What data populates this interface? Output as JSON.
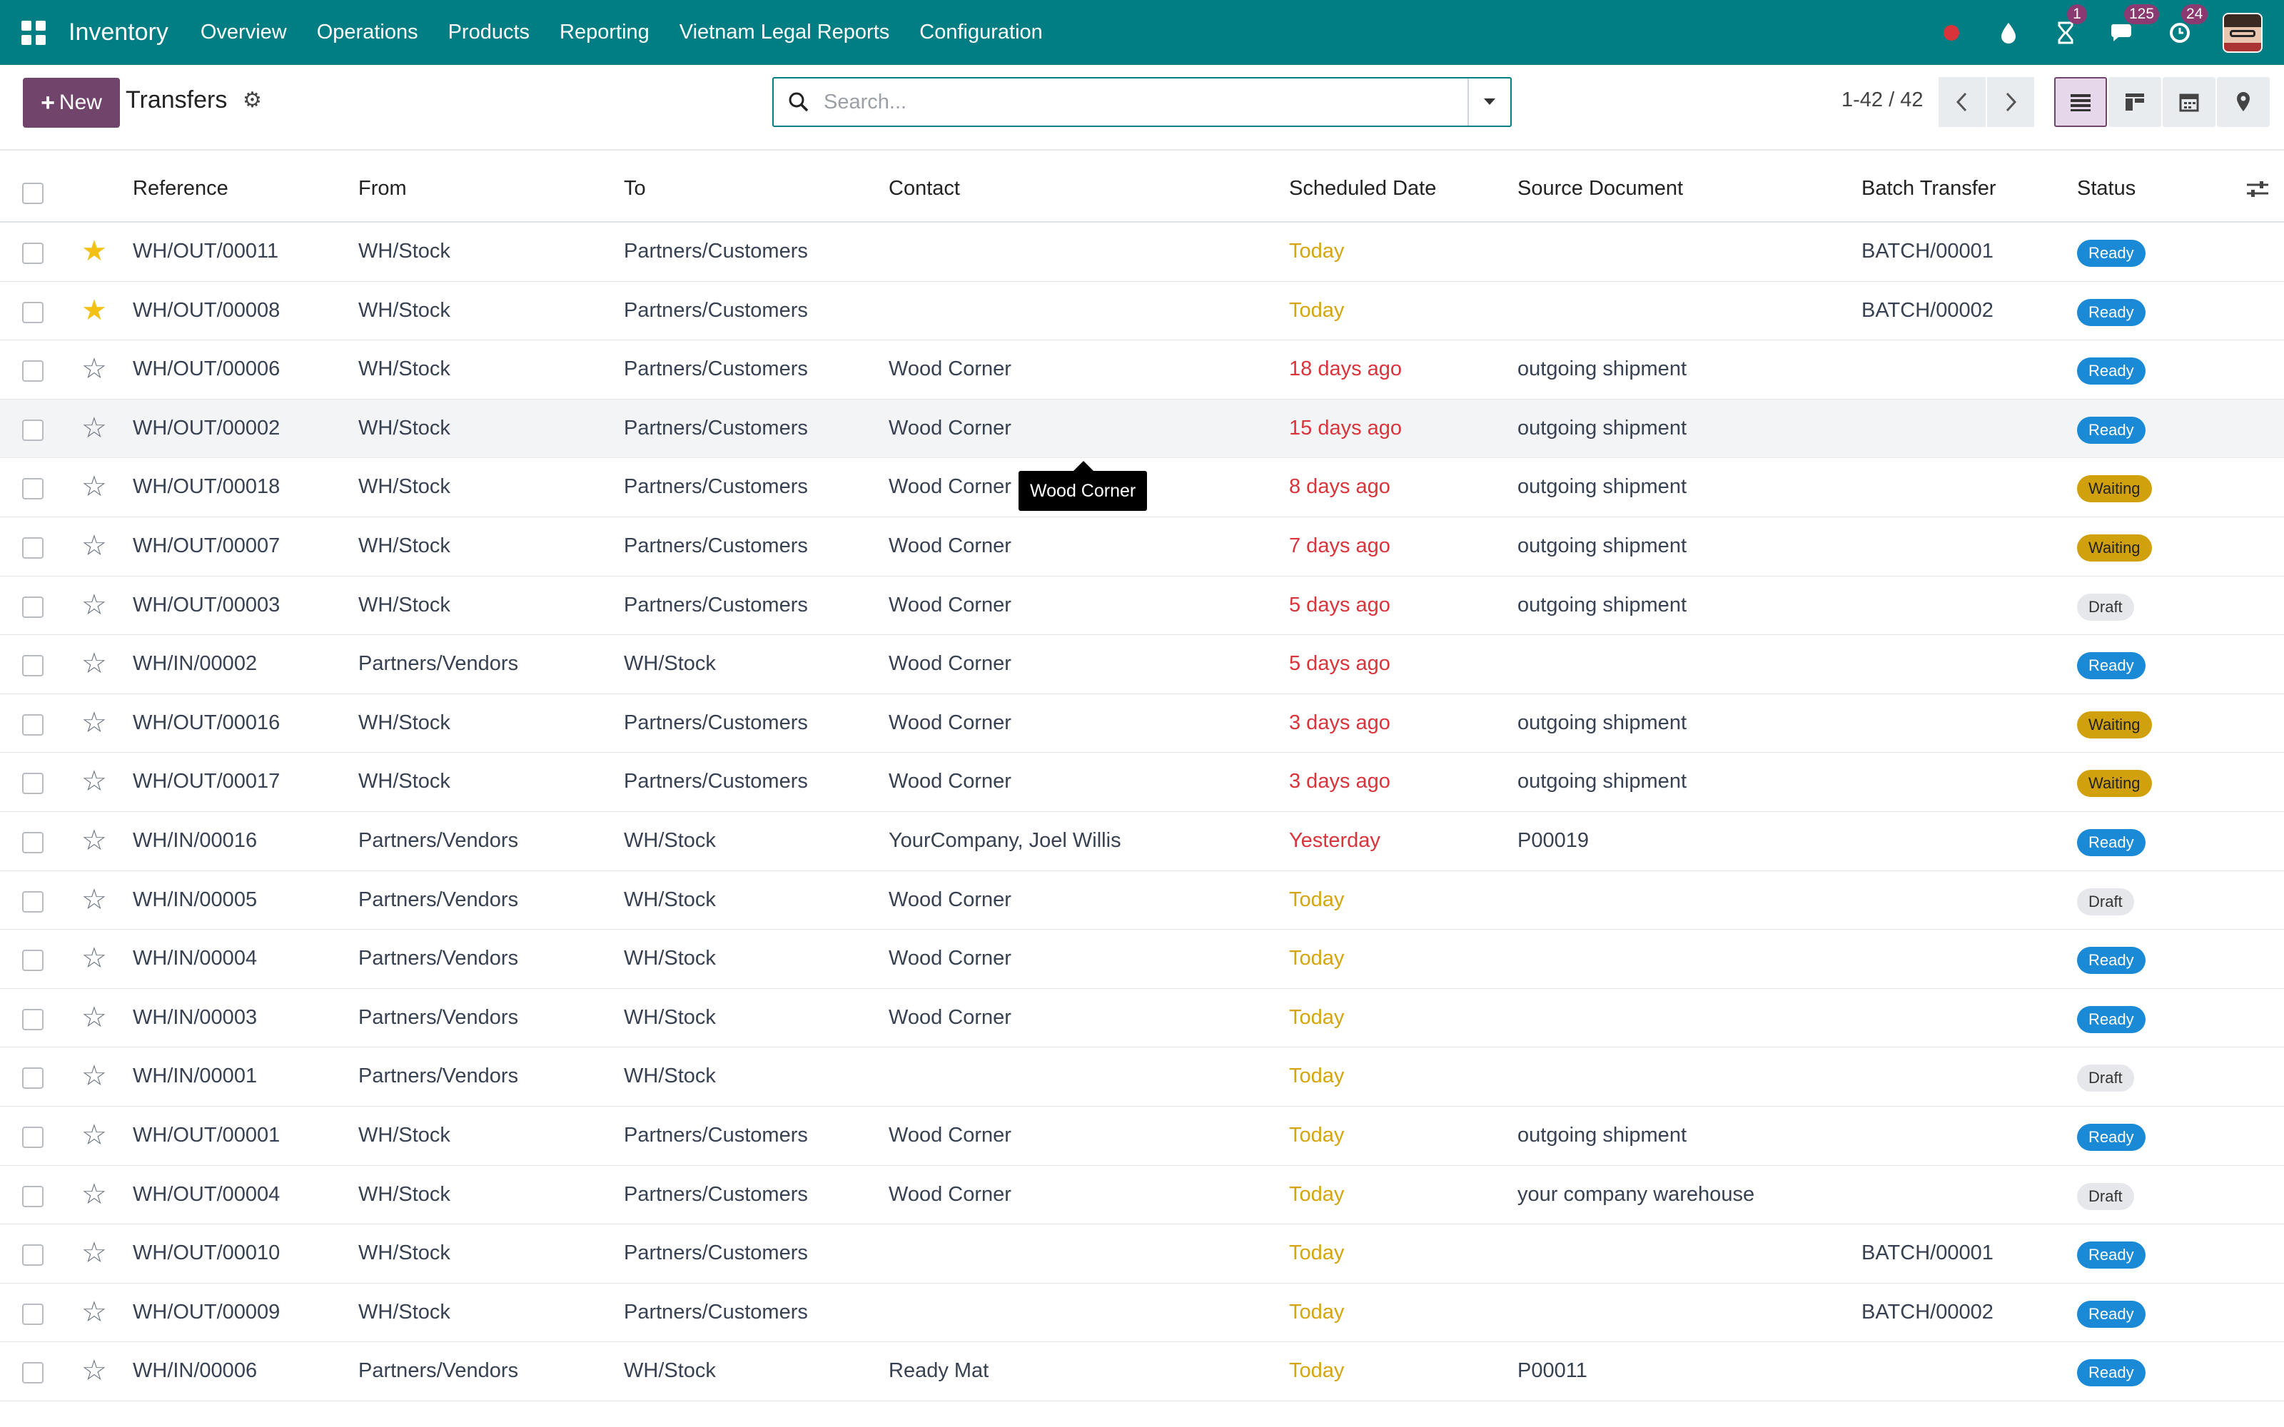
{
  "navbar": {
    "brand": "Inventory",
    "menu": [
      "Overview",
      "Operations",
      "Products",
      "Reporting",
      "Vietnam Legal Reports",
      "Configuration"
    ],
    "activities_count": "1",
    "messages_count": "125",
    "reminders_count": "24"
  },
  "control": {
    "new_label": "New",
    "title": "Transfers",
    "search_placeholder": "Search...",
    "pager": "1-42 / 42"
  },
  "columns": [
    "Reference",
    "From",
    "To",
    "Contact",
    "Scheduled Date",
    "Source Document",
    "Batch Transfer",
    "Status"
  ],
  "tooltip": "Wood Corner",
  "rows": [
    {
      "starred": true,
      "reference": "WH/OUT/00011",
      "from": "WH/Stock",
      "to": "Partners/Customers",
      "contact": "",
      "scheduled": "Today",
      "late": false,
      "source": "",
      "batch": "BATCH/00001",
      "status": "Ready",
      "status_kind": "ready"
    },
    {
      "starred": true,
      "reference": "WH/OUT/00008",
      "from": "WH/Stock",
      "to": "Partners/Customers",
      "contact": "",
      "scheduled": "Today",
      "late": false,
      "source": "",
      "batch": "BATCH/00002",
      "status": "Ready",
      "status_kind": "ready"
    },
    {
      "starred": false,
      "reference": "WH/OUT/00006",
      "from": "WH/Stock",
      "to": "Partners/Customers",
      "contact": "Wood Corner",
      "scheduled": "18 days ago",
      "late": true,
      "source": "outgoing shipment",
      "batch": "",
      "status": "Ready",
      "status_kind": "ready"
    },
    {
      "starred": false,
      "reference": "WH/OUT/00002",
      "from": "WH/Stock",
      "to": "Partners/Customers",
      "contact": "Wood Corner",
      "scheduled": "15 days ago",
      "late": true,
      "source": "outgoing shipment",
      "batch": "",
      "status": "Ready",
      "status_kind": "ready"
    },
    {
      "starred": false,
      "reference": "WH/OUT/00018",
      "from": "WH/Stock",
      "to": "Partners/Customers",
      "contact": "Wood Corner",
      "scheduled": "8 days ago",
      "late": true,
      "source": "outgoing shipment",
      "batch": "",
      "status": "Waiting",
      "status_kind": "waiting"
    },
    {
      "starred": false,
      "reference": "WH/OUT/00007",
      "from": "WH/Stock",
      "to": "Partners/Customers",
      "contact": "Wood Corner",
      "scheduled": "7 days ago",
      "late": true,
      "source": "outgoing shipment",
      "batch": "",
      "status": "Waiting",
      "status_kind": "waiting"
    },
    {
      "starred": false,
      "reference": "WH/OUT/00003",
      "from": "WH/Stock",
      "to": "Partners/Customers",
      "contact": "Wood Corner",
      "scheduled": "5 days ago",
      "late": true,
      "source": "outgoing shipment",
      "batch": "",
      "status": "Draft",
      "status_kind": "draft"
    },
    {
      "starred": false,
      "reference": "WH/IN/00002",
      "from": "Partners/Vendors",
      "to": "WH/Stock",
      "contact": "Wood Corner",
      "scheduled": "5 days ago",
      "late": true,
      "source": "",
      "batch": "",
      "status": "Ready",
      "status_kind": "ready"
    },
    {
      "starred": false,
      "reference": "WH/OUT/00016",
      "from": "WH/Stock",
      "to": "Partners/Customers",
      "contact": "Wood Corner",
      "scheduled": "3 days ago",
      "late": true,
      "source": "outgoing shipment",
      "batch": "",
      "status": "Waiting",
      "status_kind": "waiting"
    },
    {
      "starred": false,
      "reference": "WH/OUT/00017",
      "from": "WH/Stock",
      "to": "Partners/Customers",
      "contact": "Wood Corner",
      "scheduled": "3 days ago",
      "late": true,
      "source": "outgoing shipment",
      "batch": "",
      "status": "Waiting",
      "status_kind": "waiting"
    },
    {
      "starred": false,
      "reference": "WH/IN/00016",
      "from": "Partners/Vendors",
      "to": "WH/Stock",
      "contact": "YourCompany, Joel Willis",
      "scheduled": "Yesterday",
      "late": true,
      "source": "P00019",
      "batch": "",
      "status": "Ready",
      "status_kind": "ready"
    },
    {
      "starred": false,
      "reference": "WH/IN/00005",
      "from": "Partners/Vendors",
      "to": "WH/Stock",
      "contact": "Wood Corner",
      "scheduled": "Today",
      "late": false,
      "source": "",
      "batch": "",
      "status": "Draft",
      "status_kind": "draft"
    },
    {
      "starred": false,
      "reference": "WH/IN/00004",
      "from": "Partners/Vendors",
      "to": "WH/Stock",
      "contact": "Wood Corner",
      "scheduled": "Today",
      "late": false,
      "source": "",
      "batch": "",
      "status": "Ready",
      "status_kind": "ready"
    },
    {
      "starred": false,
      "reference": "WH/IN/00003",
      "from": "Partners/Vendors",
      "to": "WH/Stock",
      "contact": "Wood Corner",
      "scheduled": "Today",
      "late": false,
      "source": "",
      "batch": "",
      "status": "Ready",
      "status_kind": "ready"
    },
    {
      "starred": false,
      "reference": "WH/IN/00001",
      "from": "Partners/Vendors",
      "to": "WH/Stock",
      "contact": "",
      "scheduled": "Today",
      "late": false,
      "source": "",
      "batch": "",
      "status": "Draft",
      "status_kind": "draft"
    },
    {
      "starred": false,
      "reference": "WH/OUT/00001",
      "from": "WH/Stock",
      "to": "Partners/Customers",
      "contact": "Wood Corner",
      "scheduled": "Today",
      "late": false,
      "source": "outgoing shipment",
      "batch": "",
      "status": "Ready",
      "status_kind": "ready"
    },
    {
      "starred": false,
      "reference": "WH/OUT/00004",
      "from": "WH/Stock",
      "to": "Partners/Customers",
      "contact": "Wood Corner",
      "scheduled": "Today",
      "late": false,
      "source": "your company warehouse",
      "batch": "",
      "status": "Draft",
      "status_kind": "draft"
    },
    {
      "starred": false,
      "reference": "WH/OUT/00010",
      "from": "WH/Stock",
      "to": "Partners/Customers",
      "contact": "",
      "scheduled": "Today",
      "late": false,
      "source": "",
      "batch": "BATCH/00001",
      "status": "Ready",
      "status_kind": "ready"
    },
    {
      "starred": false,
      "reference": "WH/OUT/00009",
      "from": "WH/Stock",
      "to": "Partners/Customers",
      "contact": "",
      "scheduled": "Today",
      "late": false,
      "source": "",
      "batch": "BATCH/00002",
      "status": "Ready",
      "status_kind": "ready"
    },
    {
      "starred": false,
      "reference": "WH/IN/00006",
      "from": "Partners/Vendors",
      "to": "WH/Stock",
      "contact": "Ready Mat",
      "scheduled": "Today",
      "late": false,
      "source": "P00011",
      "batch": "",
      "status": "Ready",
      "status_kind": "ready"
    }
  ]
}
